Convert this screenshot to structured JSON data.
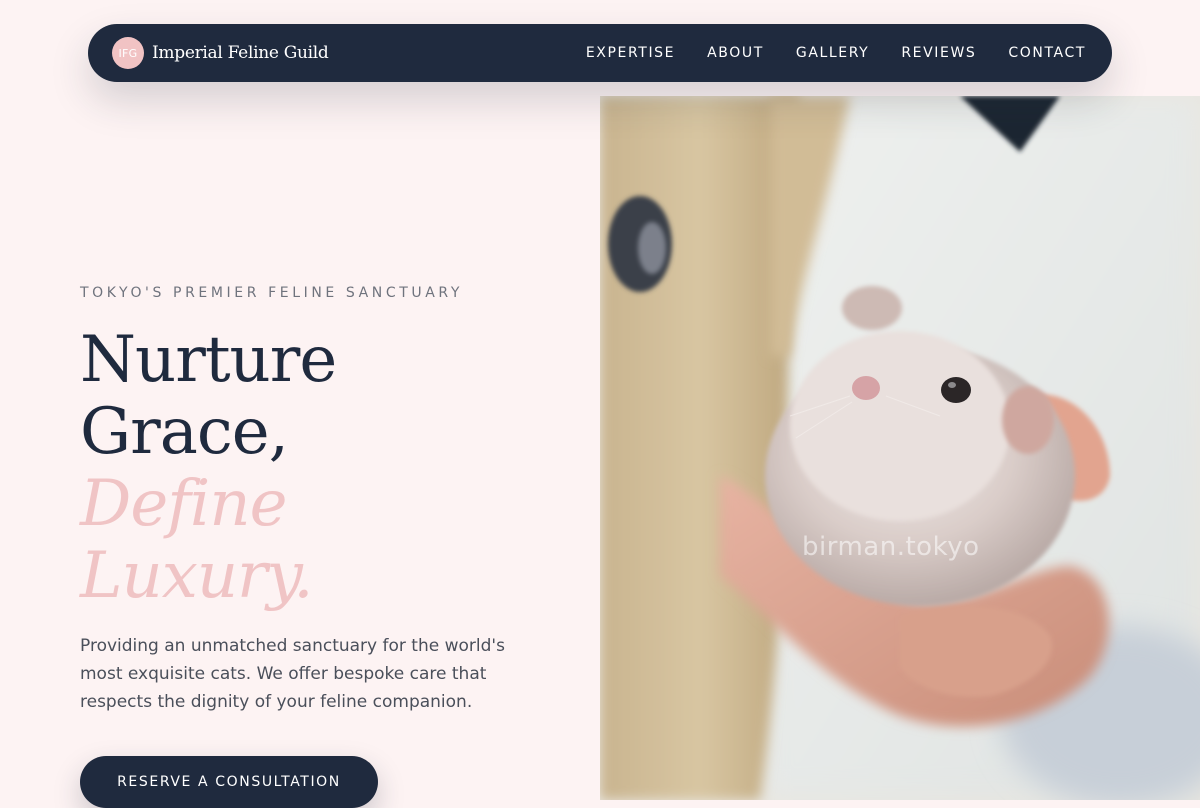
{
  "brand": {
    "badge": "IFG",
    "name": "Imperial Feline Guild"
  },
  "nav": {
    "links": [
      "EXPERTISE",
      "ABOUT",
      "GALLERY",
      "REVIEWS",
      "CONTACT"
    ]
  },
  "hero": {
    "eyebrow": "TOKYO'S PREMIER FELINE SANCTUARY",
    "headline": {
      "line1": "Nurture",
      "line2": "Grace,",
      "line3": "Define",
      "line4": "Luxury."
    },
    "description": "Providing an unmatched sanctuary for the world's most exquisite cats. We offer bespoke care that respects the dignity of your feline companion.",
    "cta_label": "RESERVE A CONSULTATION",
    "image": {
      "watermark": "birman.tokyo",
      "subject": "hamster-in-hand-photo"
    }
  },
  "colors": {
    "navy": "#1f2a3e",
    "blush": "#f0c4c5",
    "page_background": "#fdf3f3",
    "muted_text": "#6f737d"
  }
}
